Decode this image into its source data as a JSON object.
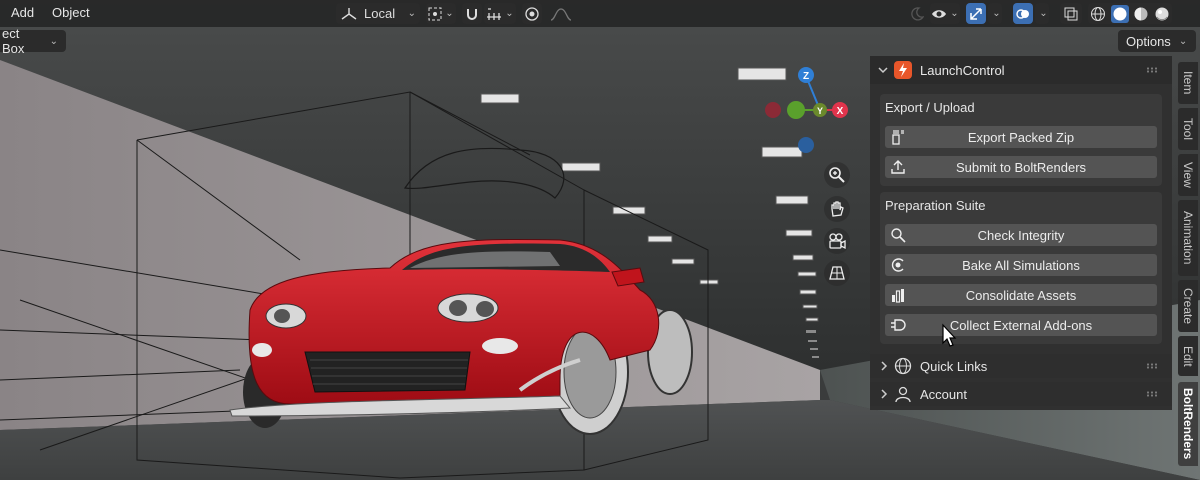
{
  "header": {
    "menu_add": "Add",
    "menu_object": "Object",
    "transform_orientation": "Local"
  },
  "toolbar": {
    "select_box": "ect Box",
    "options": "Options"
  },
  "panel": {
    "title": "LaunchControl",
    "export_section": {
      "title": "Export / Upload",
      "buttons": [
        {
          "label": "Export Packed Zip",
          "icon": "zip-icon"
        },
        {
          "label": "Submit to BoltRenders",
          "icon": "upload-icon"
        }
      ]
    },
    "prep_section": {
      "title": "Preparation Suite",
      "buttons": [
        {
          "label": "Check Integrity",
          "icon": "search-icon"
        },
        {
          "label": "Bake All Simulations",
          "icon": "bake-icon"
        },
        {
          "label": "Consolidate Assets",
          "icon": "assets-icon"
        },
        {
          "label": "Collect External Add-ons",
          "icon": "plug-icon"
        }
      ]
    },
    "quick_links": "Quick Links",
    "account": "Account"
  },
  "gizmo": {
    "z": "Z",
    "x": "X",
    "y": "Y"
  },
  "tabs": [
    "Item",
    "Tool",
    "View",
    "Animation",
    "Create",
    "Edit",
    "BoltRenders"
  ],
  "colors": {
    "accent": "#3c6fb3",
    "car_red": "#c0141c",
    "axis_x": "#e0344c",
    "axis_y": "#5aa02c",
    "axis_z": "#2f7fd6"
  }
}
